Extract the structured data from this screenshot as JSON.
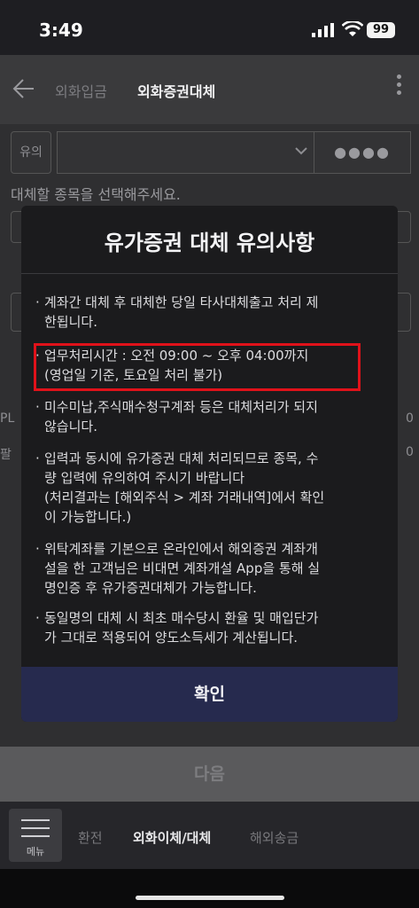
{
  "status_bar": {
    "time": "3:49",
    "battery": "99"
  },
  "header": {
    "tabs": [
      {
        "label": "외화입금"
      },
      {
        "label": "외화증권대체"
      }
    ]
  },
  "background": {
    "account_label": "유의",
    "password_mask": "●●●●",
    "select_hint": "대체할 종목을 선택해주세요.",
    "pl_label": "PL",
    "pl_value": "0",
    "sell_label": "팔",
    "sell_value": "0",
    "next_label": "다음"
  },
  "modal": {
    "title": "유가증권 대체 유의사항",
    "notes": [
      "계좌간 대체 후 대체한 당일 타사대체출고 처리 제\n한됩니다.",
      "업무처리시간 : 오전 09:00 ~ 오후 04:00까지\n(영업일 기준, 토요일 처리 불가)",
      "미수미납,주식매수청구계좌 등은 대체처리가 되지\n않습니다.",
      "입력과 동시에 유가증권 대체 처리되므로 종목,  수\n량 입력에 유의하여 주시기 바랍니다\n(처리결과는 [해외주식 > 계좌 거래내역]에서 확인\n이 가능합니다.)",
      "위탁계좌를 기본으로 온라인에서 해외증권 계좌개\n설을 한 고객님은 비대면 계좌개설 App을 통해 실\n명인증 후 유가증권대체가 가능합니다.",
      "동일명의 대체 시 최초 매수당시 환율 및 매입단가\n가 그대로 적용되어 양도소득세가 계산됩니다."
    ],
    "confirm_label": "확인"
  },
  "bottom_nav": {
    "menu_label": "메뉴",
    "items": [
      {
        "label": "환전"
      },
      {
        "label": "외화이체/대체"
      },
      {
        "label": "해외송금"
      }
    ]
  },
  "colors": {
    "highlight_border": "#e0121a",
    "confirm_bg": "#262a4e",
    "modal_bg": "#1b1b1d"
  }
}
